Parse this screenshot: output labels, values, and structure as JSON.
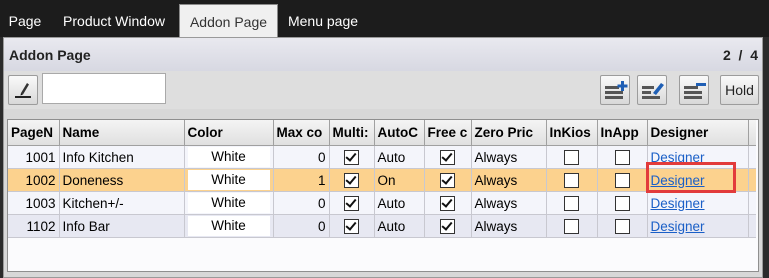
{
  "tabs": [
    {
      "label": "Page"
    },
    {
      "label": "Product Window"
    },
    {
      "label": "Addon Page"
    },
    {
      "label": "Menu page"
    }
  ],
  "header": {
    "title": "Addon Page",
    "page_current": "2",
    "page_sep": "/",
    "page_total": "4"
  },
  "toolbar": {
    "search_value": "",
    "hold_label": "Hold"
  },
  "grid": {
    "columns": [
      "PageN",
      "Name",
      "Color",
      "Max co",
      "Multi:",
      "AutoC",
      "Free c",
      "Zero Pric",
      "InKios",
      "InApp",
      "Designer"
    ],
    "rows": [
      {
        "page": "1001",
        "name": "Info Kitchen",
        "color": "White",
        "max": "0",
        "multi": true,
        "auto": "Auto",
        "free": true,
        "zero": "Always",
        "inkiosk": false,
        "inapp": false,
        "designer": "Designer"
      },
      {
        "page": "1002",
        "name": "Doneness",
        "color": "White",
        "max": "1",
        "multi": true,
        "auto": "On",
        "free": true,
        "zero": "Always",
        "inkiosk": false,
        "inapp": false,
        "designer": "Designer"
      },
      {
        "page": "1003",
        "name": "Kitchen+/-",
        "color": "White",
        "max": "0",
        "multi": true,
        "auto": "Auto",
        "free": true,
        "zero": "Always",
        "inkiosk": false,
        "inapp": false,
        "designer": "Designer"
      },
      {
        "page": "1102",
        "name": "Info Bar",
        "color": "White",
        "max": "0",
        "multi": true,
        "auto": "Auto",
        "free": true,
        "zero": "Always",
        "inkiosk": false,
        "inapp": false,
        "designer": "Designer"
      }
    ]
  },
  "colors": {
    "selected_row": "#fcd28e",
    "highlight_box": "#e23b3b",
    "link": "#1a5fc7"
  }
}
